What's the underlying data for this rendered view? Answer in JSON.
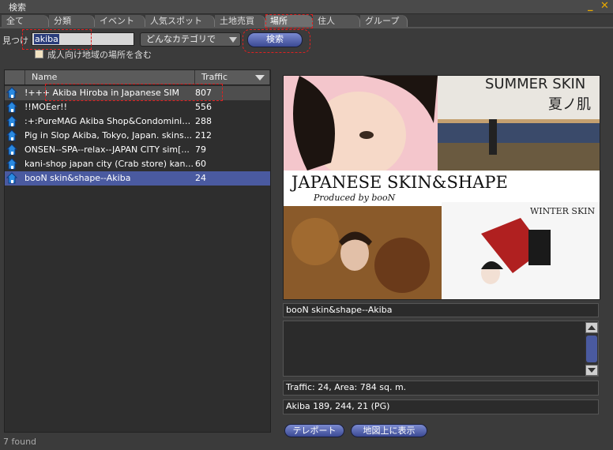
{
  "window": {
    "title": "検索",
    "minimize_glyph": "_",
    "close_glyph": "✕"
  },
  "tabs": [
    {
      "label": "全て"
    },
    {
      "label": "分類"
    },
    {
      "label": "イベント"
    },
    {
      "label": "人気スポット"
    },
    {
      "label": "土地売買"
    },
    {
      "label": "場所",
      "active": true
    },
    {
      "label": "住人"
    },
    {
      "label": "グループ"
    }
  ],
  "search": {
    "find_label": "見つけ",
    "query": "akiba",
    "category_selected": "どんなカテゴリで",
    "search_button": "検索",
    "mature_checkbox_label": "成人向け地域の場所を含む"
  },
  "results": {
    "columns": {
      "name": "Name",
      "traffic": "Traffic"
    },
    "rows": [
      {
        "name": "!+++ Akiba Hiroba in Japanese SIM",
        "traffic": "807"
      },
      {
        "name": "!!MOEer!!",
        "traffic": "556"
      },
      {
        "name": ":+:PureMAG Akiba Shop&Condominiu...",
        "traffic": "288"
      },
      {
        "name": "Pig in Slop Akiba, Tokyo, Japan. skins...",
        "traffic": "212"
      },
      {
        "name": "ONSEN--SPA--relax--JAPAN CITY sim[...",
        "traffic": "79"
      },
      {
        "name": "kani-shop japan city (Crab store) kan...",
        "traffic": "60"
      },
      {
        "name": "booN skin&shape--Akiba",
        "traffic": "24"
      }
    ],
    "found_text": "7 found"
  },
  "detail": {
    "image_text": {
      "summer": "SUMMER SKIN",
      "summer_jp": "夏ノ肌",
      "banner": "JAPANESE SKIN&SHAPE",
      "produced": "Produced by booN",
      "winter": "WINTER SKIN"
    },
    "name": "booN skin&shape--Akiba",
    "description": "",
    "traffic_area": "Traffic: 24, Area: 784 sq. m.",
    "location": "Akiba 189, 244, 21 (PG)",
    "teleport_button": "テレポート",
    "map_button": "地図上に表示"
  },
  "colors": {
    "accent": "#e8a800",
    "selection": "#4a5aa0",
    "highlight_box": "#e02020"
  }
}
